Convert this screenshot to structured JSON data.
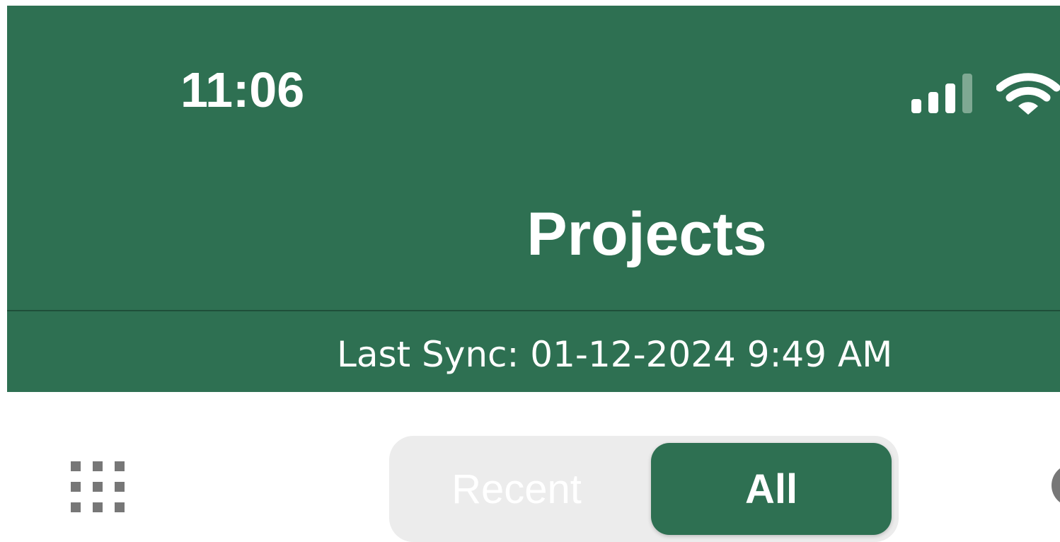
{
  "status_bar": {
    "time": "11:06",
    "signal_icon": "cellular-signal-icon",
    "wifi_icon": "wifi-icon"
  },
  "header": {
    "title": "Projects",
    "last_sync": "Last Sync: 01-12-2024 9:49 AM"
  },
  "toolbar": {
    "grid_icon": "grid-menu-icon",
    "segments": {
      "recent": "Recent",
      "all": "All",
      "selected": "All"
    },
    "right_icon": "info-icon"
  },
  "colors": {
    "brand_green": "#2e7052",
    "segment_bg": "#ececec",
    "icon_gray": "#777777"
  }
}
